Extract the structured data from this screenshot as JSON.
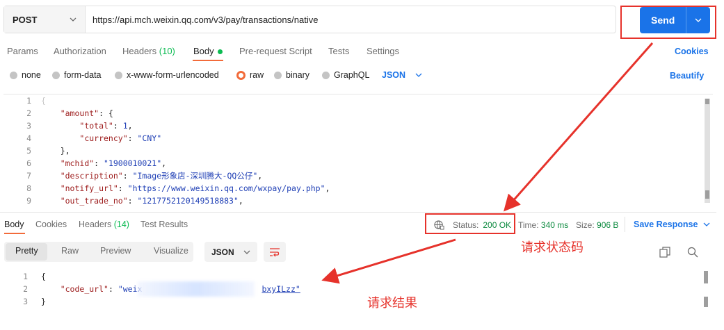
{
  "request": {
    "method": "POST",
    "url": "https://api.mch.weixin.qq.com/v3/pay/transactions/native",
    "send_label": "Send"
  },
  "req_tabs": {
    "params": "Params",
    "authorization": "Authorization",
    "headers": "Headers",
    "headers_count": "(10)",
    "body": "Body",
    "prerequest": "Pre-request Script",
    "tests": "Tests",
    "settings": "Settings",
    "cookies": "Cookies"
  },
  "body_types": {
    "none": "none",
    "form_data": "form-data",
    "urlencoded": "x-www-form-urlencoded",
    "raw": "raw",
    "binary": "binary",
    "graphql": "GraphQL",
    "format": "JSON",
    "beautify": "Beautify"
  },
  "editor": {
    "line_numbers": [
      "1",
      "2",
      "3",
      "4",
      "5",
      "6",
      "7",
      "8",
      "9"
    ],
    "lines": [
      {
        "pre": "{",
        "key": "",
        "mid": "",
        "val": "",
        "post": ""
      },
      {
        "pre": "    ",
        "key": "\"amount\"",
        "mid": ": {",
        "val": "",
        "post": ""
      },
      {
        "pre": "        ",
        "key": "\"total\"",
        "mid": ": ",
        "val": "1",
        "post": ","
      },
      {
        "pre": "        ",
        "key": "\"currency\"",
        "mid": ": ",
        "val": "\"CNY\"",
        "post": ""
      },
      {
        "pre": "    ",
        "key": "",
        "mid": "},",
        "val": "",
        "post": ""
      },
      {
        "pre": "    ",
        "key": "\"mchid\"",
        "mid": ": ",
        "val": "\"1900010021\"",
        "post": ","
      },
      {
        "pre": "    ",
        "key": "\"description\"",
        "mid": ": ",
        "val": "\"Image形象店-深圳腾大-QQ公仔\"",
        "post": ","
      },
      {
        "pre": "    ",
        "key": "\"notify_url\"",
        "mid": ": ",
        "val": "\"https://www.weixin.qq.com/wxpay/pay.php\"",
        "post": ","
      },
      {
        "pre": "    ",
        "key": "\"out_trade_no\"",
        "mid": ": ",
        "val": "\"1217752120149518883\"",
        "post": ","
      }
    ]
  },
  "resp_tabs": {
    "body": "Body",
    "cookies": "Cookies",
    "headers": "Headers",
    "headers_count": "(14)",
    "test_results": "Test Results"
  },
  "response_meta": {
    "status_label": "Status:",
    "status_value": "200 OK",
    "time_label": "Time:",
    "time_value": "340 ms",
    "size_label": "Size:",
    "size_value": "906 B",
    "save_response": "Save Response"
  },
  "view_tabs": {
    "pretty": "Pretty",
    "raw": "Raw",
    "preview": "Preview",
    "visualize": "Visualize",
    "format": "JSON"
  },
  "response_body": {
    "line_numbers": [
      "1",
      "2",
      "3"
    ],
    "line1": "{",
    "key": "\"code_url\"",
    "colon": ": ",
    "val_start": "\"weix",
    "val_end": "bxyILzz\"",
    "line3": "}"
  },
  "annotations": {
    "status_note": "请求状态码",
    "result_note": "请求结果"
  },
  "colors": {
    "accent": "#1a73e8",
    "annotation": "#e6322b",
    "status_ok": "#0c8a3f",
    "active_dot": "#0cbb52"
  }
}
